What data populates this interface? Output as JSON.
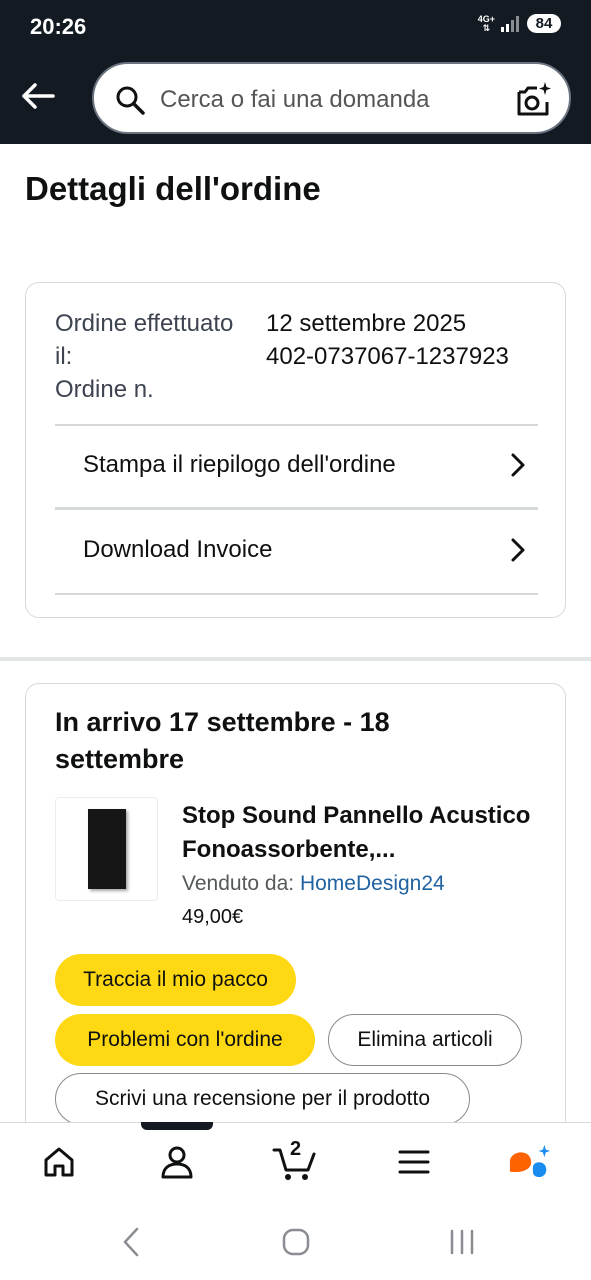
{
  "status_bar": {
    "time": "20:26",
    "network": "4G+",
    "battery": "84"
  },
  "header": {
    "search_placeholder": "Cerca o fai una domanda",
    "back_icon": "back-arrow-icon",
    "camera_icon": "camera-icon"
  },
  "page": {
    "title": "Dettagli dell'ordine"
  },
  "order_info": {
    "date_label": "Ordine effettuato il:",
    "date_value": "12 settembre 2025",
    "number_label": "Ordine n.",
    "number_value": "402-0737067-1237923",
    "links": [
      {
        "label": "Stampa il riepilogo dell'ordine"
      },
      {
        "label": "Download Invoice"
      }
    ]
  },
  "shipment": {
    "arrival": "In arrivo 17 settembre - 18 settembre",
    "product": {
      "title": "Stop Sound Pannello Acustico Fonoassorbente,...",
      "seller_label": "Venduto da: ",
      "seller_name": "HomeDesign24",
      "price": "49,00€"
    },
    "buttons": {
      "track": "Traccia il mio pacco",
      "problems": "Problemi con l'ordine",
      "delete": "Elimina articoli",
      "review": "Scrivi una recensione per il prodotto"
    }
  },
  "bottom_nav": {
    "cart_count": "2",
    "items": [
      "home-icon",
      "account-icon",
      "cart-icon",
      "menu-icon",
      "rufus-icon"
    ]
  },
  "colors": {
    "header_bg": "#131a22",
    "button_yellow": "#ffd814",
    "link_blue": "#2162a1"
  }
}
